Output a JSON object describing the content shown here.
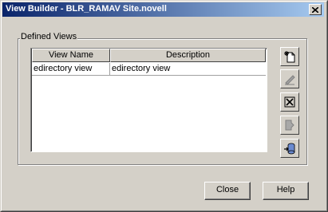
{
  "window": {
    "title": "View Builder - BLR_RAMAV Site.novell",
    "close_glyph": "✕"
  },
  "defined_views": {
    "group_label": "Defined Views",
    "columns": [
      "View Name",
      "Description"
    ],
    "rows": [
      {
        "view_name": "edirectory view",
        "description": "edirectory view"
      }
    ]
  },
  "toolbar": {
    "icons": [
      "new-view-icon",
      "edit-view-icon",
      "delete-view-icon",
      "run-view-icon",
      "import-view-icon"
    ]
  },
  "footer": {
    "close_label": "Close",
    "help_label": "Help"
  }
}
